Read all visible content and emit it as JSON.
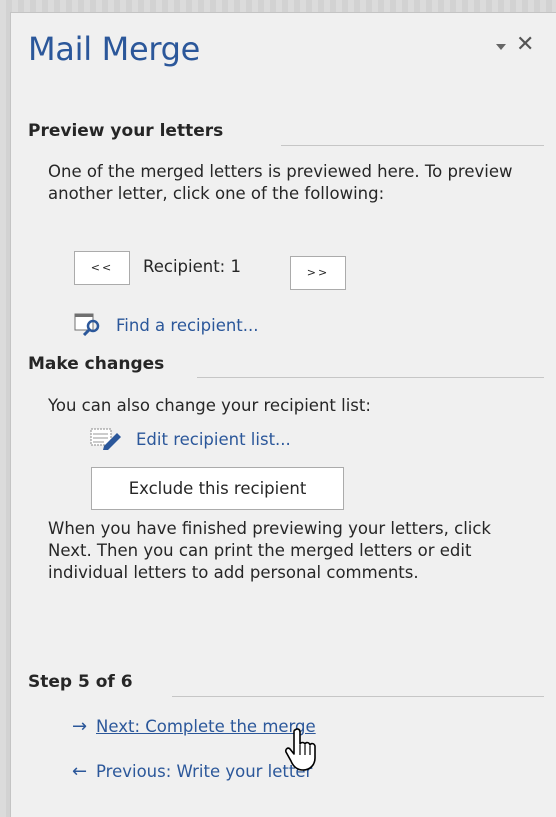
{
  "pane": {
    "title": "Mail Merge"
  },
  "preview": {
    "heading": "Preview your letters",
    "description": "One of the merged letters is previewed here. To preview another letter, click one of the following:",
    "prev_button": "<<",
    "recipient_label": "Recipient: 1",
    "next_button": ">>",
    "find_link": "Find a recipient..."
  },
  "changes": {
    "heading": "Make changes",
    "description": "You can also change your recipient list:",
    "edit_link": "Edit recipient list...",
    "exclude_button": "Exclude this recipient",
    "finish_text": "When you have finished previewing your letters, click Next. Then you can print the merged letters or edit individual letters to add personal comments."
  },
  "step": {
    "heading": "Step 5 of 6",
    "next_link": "Next: Complete the merge",
    "previous_link": "Previous: Write your letter"
  },
  "colors": {
    "accent": "#2b579a",
    "pane_bg": "#f0f0f0"
  }
}
